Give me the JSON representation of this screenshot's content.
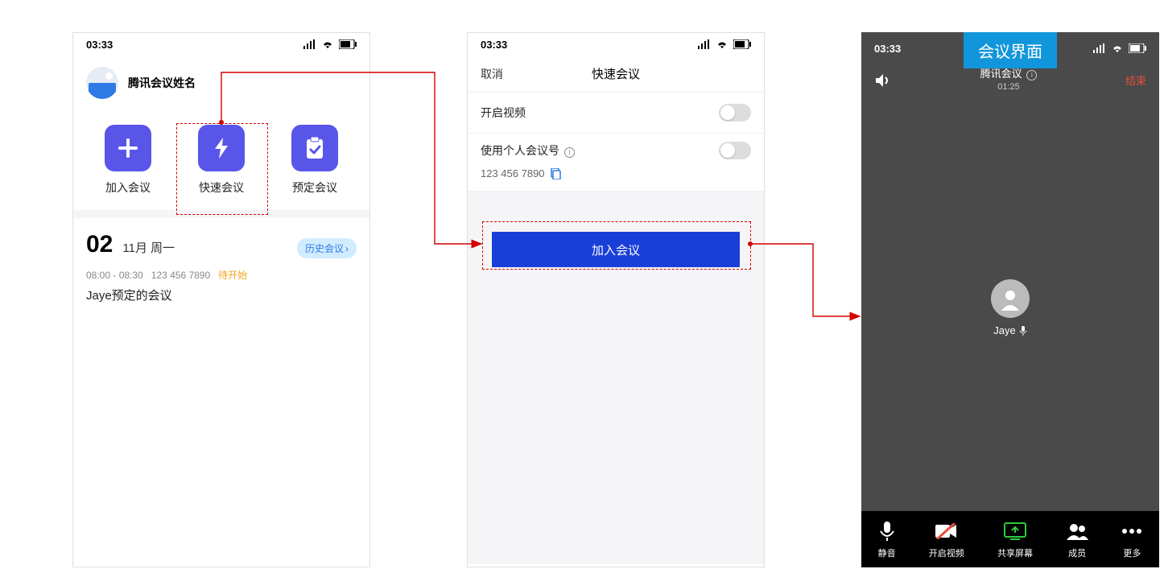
{
  "statusbar": {
    "time": "03:33"
  },
  "phone1": {
    "username": "腾讯会议姓名",
    "actions": {
      "join": "加入会议",
      "quick": "快速会议",
      "schedule": "预定会议"
    },
    "date": {
      "day": "02",
      "text": "11月 周一"
    },
    "history_label": "历史会议",
    "meeting": {
      "time": "08:00 - 08:30",
      "id": "123 456 7890",
      "status": "待开始",
      "title": "Jaye预定的会议"
    }
  },
  "phone2": {
    "cancel": "取消",
    "title": "快速会议",
    "row_video": "开启视频",
    "row_personal": "使用个人会议号",
    "meeting_id": "123 456 7890",
    "join_button": "加入会议"
  },
  "phone3": {
    "banner": "会议界面",
    "meeting_name": "腾讯会议",
    "elapsed": "01:25",
    "end_label": "结束",
    "participant": "Jaye",
    "toolbar": {
      "mute": "静音",
      "video": "开启视频",
      "share": "共享屏幕",
      "members": "成员",
      "more": "更多"
    }
  }
}
